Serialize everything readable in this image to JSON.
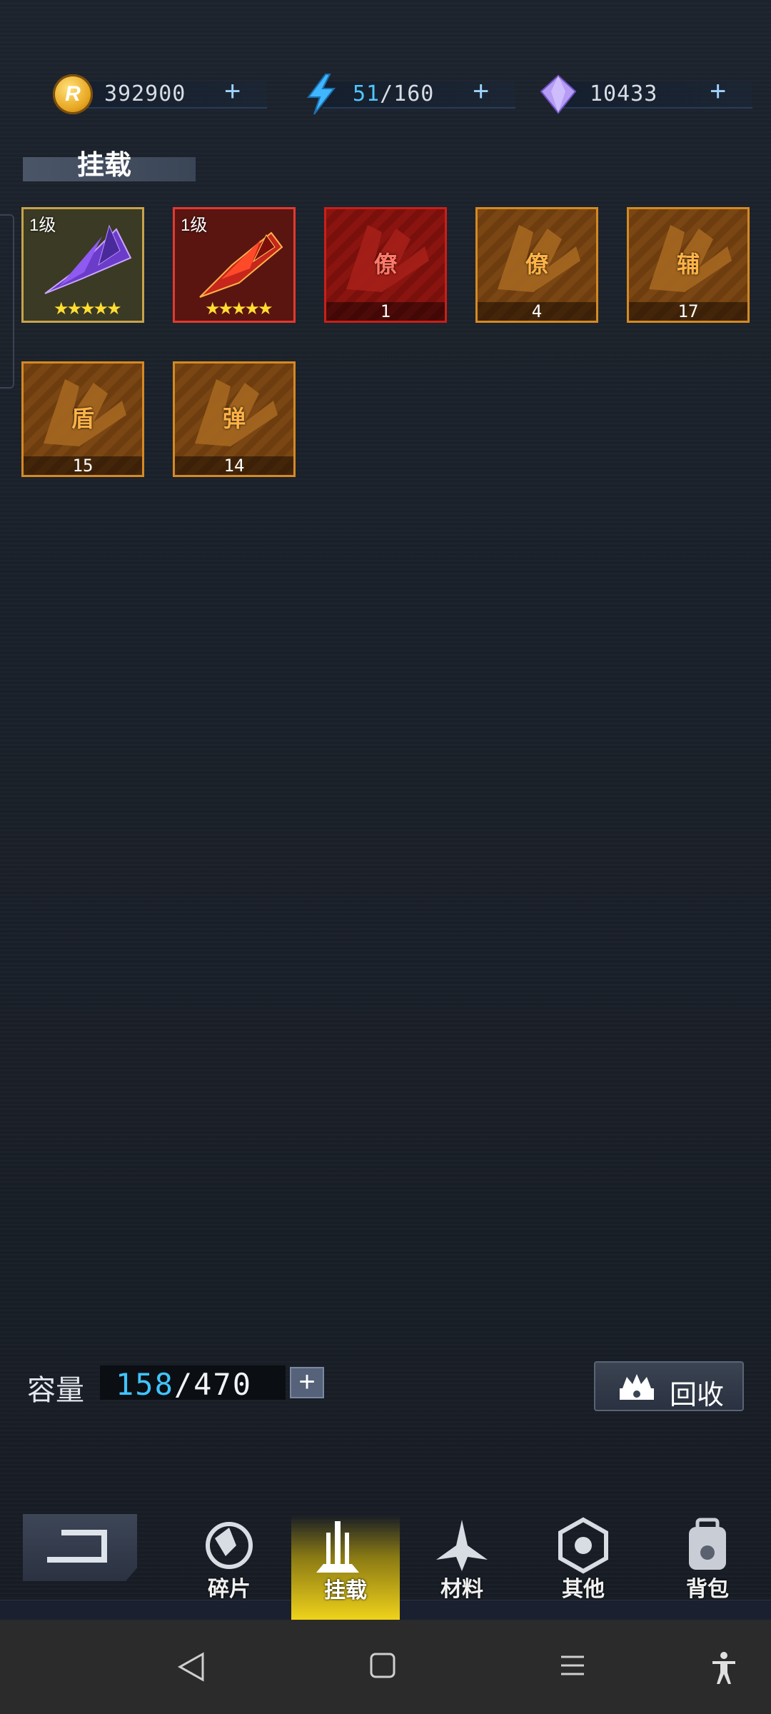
{
  "resources": {
    "coins": {
      "icon": "r-coin-icon",
      "value": "392900",
      "add": "+"
    },
    "energy": {
      "icon": "lightning-icon",
      "current": "51",
      "max": "/160",
      "add": "+"
    },
    "gems": {
      "icon": "crystal-icon",
      "value": "10433",
      "add": "+"
    }
  },
  "section": {
    "title": "挂载"
  },
  "items": [
    {
      "kind": "ship",
      "style": "gold",
      "level": "1级",
      "stars": "★★★★★",
      "icon": "purple-fighter-icon"
    },
    {
      "kind": "ship",
      "style": "redf",
      "level": "1级",
      "stars": "★★★★★",
      "icon": "red-fighter-icon"
    },
    {
      "kind": "fragment",
      "style": "red",
      "glyph": "僚",
      "count": "1"
    },
    {
      "kind": "fragment",
      "style": "orange",
      "glyph": "僚",
      "count": "4"
    },
    {
      "kind": "fragment",
      "style": "orange",
      "glyph": "辅",
      "count": "17"
    },
    {
      "kind": "fragment",
      "style": "orange",
      "glyph": "盾",
      "count": "15"
    },
    {
      "kind": "fragment",
      "style": "orange",
      "glyph": "弹",
      "count": "14"
    }
  ],
  "capacity": {
    "label": "容量",
    "used": "158",
    "total": "/470",
    "add": "+"
  },
  "recycle": {
    "label": "回收",
    "icon": "recycle-bin-icon"
  },
  "nav": {
    "back_icon": "back-arrow-icon",
    "tabs": [
      {
        "label": "碎片",
        "icon": "fragments-icon",
        "active": false
      },
      {
        "label": "挂载",
        "icon": "mount-icon",
        "active": true
      },
      {
        "label": "材料",
        "icon": "materials-icon",
        "active": false
      },
      {
        "label": "其他",
        "icon": "other-icon",
        "active": false
      },
      {
        "label": "背包",
        "icon": "backpack-icon",
        "active": false
      }
    ]
  },
  "system_bar": {
    "icons": [
      "back-triangle-icon",
      "home-square-icon",
      "menu-lines-icon",
      "accessibility-icon"
    ]
  },
  "colors": {
    "accent_cyan": "#41c4ff",
    "gold": "#f0d21a",
    "fragment_orange": "#d58a24",
    "fragment_red": "#c8201a"
  }
}
